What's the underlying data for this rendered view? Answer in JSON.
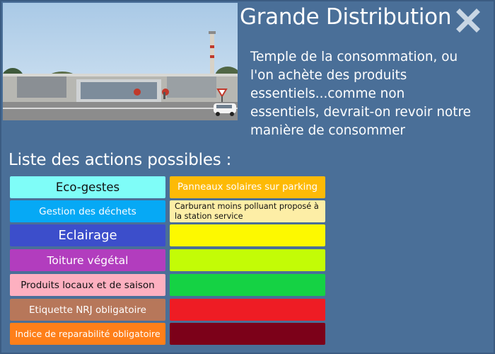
{
  "header": {
    "title": "Grande Distribution",
    "description": "Temple de la consommation, ou l'on achète des produits essentiels...comme non essentiels, devrait-on revoir notre manière de consommer"
  },
  "icons": {
    "close": "close-x-icon"
  },
  "section": {
    "title": "Liste des actions possibles :"
  },
  "actions": [
    {
      "label": "Eco-gestes",
      "color": "#7ffdf8",
      "text_color": "#111111"
    },
    {
      "label": "Gestion des déchets",
      "color": "#06a9f5",
      "text_color": "#ffffff"
    },
    {
      "label": "Eclairage",
      "color": "#3c4ecb",
      "text_color": "#ffffff"
    },
    {
      "label": "Toiture végétal",
      "color": "#b23dbe",
      "text_color": "#ffffff"
    },
    {
      "label": "Produits locaux et de saison",
      "color": "#fdb0c0",
      "text_color": "#111111"
    },
    {
      "label": "Etiquette NRJ obligatoire",
      "color": "#b7775a",
      "text_color": "#ffffff"
    },
    {
      "label": "Indice de reparabilité obligatoire",
      "color": "#fe7f19",
      "text_color": "#ffffff"
    }
  ],
  "slots": [
    {
      "text": "Panneaux solaires sur parking",
      "color": "#fdba06",
      "text_color": "#ffffff"
    },
    {
      "text": "Carburant moins polluant proposé à la station service",
      "color": "#fdeea6",
      "text_color": "#111111"
    },
    {
      "text": "",
      "color": "#fdf900"
    },
    {
      "text": "",
      "color": "#c3fc06"
    },
    {
      "text": "",
      "color": "#15d244"
    },
    {
      "text": "",
      "color": "#ee1c24"
    },
    {
      "text": "",
      "color": "#7c0119"
    }
  ]
}
